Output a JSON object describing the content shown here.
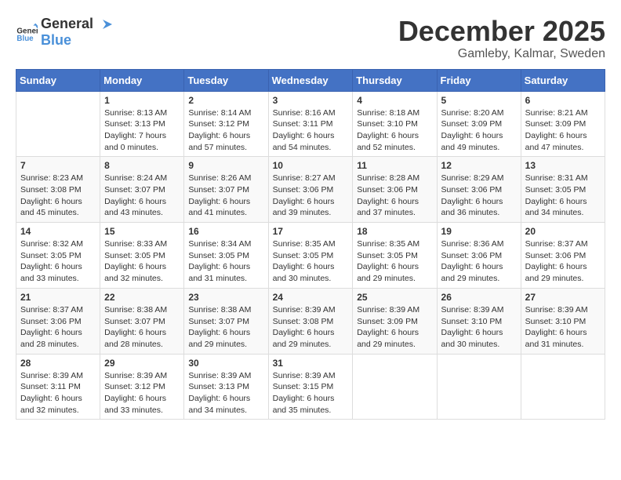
{
  "logo": {
    "general": "General",
    "blue": "Blue"
  },
  "header": {
    "month": "December 2025",
    "location": "Gamleby, Kalmar, Sweden"
  },
  "weekdays": [
    "Sunday",
    "Monday",
    "Tuesday",
    "Wednesday",
    "Thursday",
    "Friday",
    "Saturday"
  ],
  "weeks": [
    [
      {
        "day": "",
        "sunrise": "",
        "sunset": "",
        "daylight": ""
      },
      {
        "day": "1",
        "sunrise": "Sunrise: 8:13 AM",
        "sunset": "Sunset: 3:13 PM",
        "daylight": "Daylight: 7 hours and 0 minutes."
      },
      {
        "day": "2",
        "sunrise": "Sunrise: 8:14 AM",
        "sunset": "Sunset: 3:12 PM",
        "daylight": "Daylight: 6 hours and 57 minutes."
      },
      {
        "day": "3",
        "sunrise": "Sunrise: 8:16 AM",
        "sunset": "Sunset: 3:11 PM",
        "daylight": "Daylight: 6 hours and 54 minutes."
      },
      {
        "day": "4",
        "sunrise": "Sunrise: 8:18 AM",
        "sunset": "Sunset: 3:10 PM",
        "daylight": "Daylight: 6 hours and 52 minutes."
      },
      {
        "day": "5",
        "sunrise": "Sunrise: 8:20 AM",
        "sunset": "Sunset: 3:09 PM",
        "daylight": "Daylight: 6 hours and 49 minutes."
      },
      {
        "day": "6",
        "sunrise": "Sunrise: 8:21 AM",
        "sunset": "Sunset: 3:09 PM",
        "daylight": "Daylight: 6 hours and 47 minutes."
      }
    ],
    [
      {
        "day": "7",
        "sunrise": "Sunrise: 8:23 AM",
        "sunset": "Sunset: 3:08 PM",
        "daylight": "Daylight: 6 hours and 45 minutes."
      },
      {
        "day": "8",
        "sunrise": "Sunrise: 8:24 AM",
        "sunset": "Sunset: 3:07 PM",
        "daylight": "Daylight: 6 hours and 43 minutes."
      },
      {
        "day": "9",
        "sunrise": "Sunrise: 8:26 AM",
        "sunset": "Sunset: 3:07 PM",
        "daylight": "Daylight: 6 hours and 41 minutes."
      },
      {
        "day": "10",
        "sunrise": "Sunrise: 8:27 AM",
        "sunset": "Sunset: 3:06 PM",
        "daylight": "Daylight: 6 hours and 39 minutes."
      },
      {
        "day": "11",
        "sunrise": "Sunrise: 8:28 AM",
        "sunset": "Sunset: 3:06 PM",
        "daylight": "Daylight: 6 hours and 37 minutes."
      },
      {
        "day": "12",
        "sunrise": "Sunrise: 8:29 AM",
        "sunset": "Sunset: 3:06 PM",
        "daylight": "Daylight: 6 hours and 36 minutes."
      },
      {
        "day": "13",
        "sunrise": "Sunrise: 8:31 AM",
        "sunset": "Sunset: 3:05 PM",
        "daylight": "Daylight: 6 hours and 34 minutes."
      }
    ],
    [
      {
        "day": "14",
        "sunrise": "Sunrise: 8:32 AM",
        "sunset": "Sunset: 3:05 PM",
        "daylight": "Daylight: 6 hours and 33 minutes."
      },
      {
        "day": "15",
        "sunrise": "Sunrise: 8:33 AM",
        "sunset": "Sunset: 3:05 PM",
        "daylight": "Daylight: 6 hours and 32 minutes."
      },
      {
        "day": "16",
        "sunrise": "Sunrise: 8:34 AM",
        "sunset": "Sunset: 3:05 PM",
        "daylight": "Daylight: 6 hours and 31 minutes."
      },
      {
        "day": "17",
        "sunrise": "Sunrise: 8:35 AM",
        "sunset": "Sunset: 3:05 PM",
        "daylight": "Daylight: 6 hours and 30 minutes."
      },
      {
        "day": "18",
        "sunrise": "Sunrise: 8:35 AM",
        "sunset": "Sunset: 3:05 PM",
        "daylight": "Daylight: 6 hours and 29 minutes."
      },
      {
        "day": "19",
        "sunrise": "Sunrise: 8:36 AM",
        "sunset": "Sunset: 3:06 PM",
        "daylight": "Daylight: 6 hours and 29 minutes."
      },
      {
        "day": "20",
        "sunrise": "Sunrise: 8:37 AM",
        "sunset": "Sunset: 3:06 PM",
        "daylight": "Daylight: 6 hours and 29 minutes."
      }
    ],
    [
      {
        "day": "21",
        "sunrise": "Sunrise: 8:37 AM",
        "sunset": "Sunset: 3:06 PM",
        "daylight": "Daylight: 6 hours and 28 minutes."
      },
      {
        "day": "22",
        "sunrise": "Sunrise: 8:38 AM",
        "sunset": "Sunset: 3:07 PM",
        "daylight": "Daylight: 6 hours and 28 minutes."
      },
      {
        "day": "23",
        "sunrise": "Sunrise: 8:38 AM",
        "sunset": "Sunset: 3:07 PM",
        "daylight": "Daylight: 6 hours and 29 minutes."
      },
      {
        "day": "24",
        "sunrise": "Sunrise: 8:39 AM",
        "sunset": "Sunset: 3:08 PM",
        "daylight": "Daylight: 6 hours and 29 minutes."
      },
      {
        "day": "25",
        "sunrise": "Sunrise: 8:39 AM",
        "sunset": "Sunset: 3:09 PM",
        "daylight": "Daylight: 6 hours and 29 minutes."
      },
      {
        "day": "26",
        "sunrise": "Sunrise: 8:39 AM",
        "sunset": "Sunset: 3:10 PM",
        "daylight": "Daylight: 6 hours and 30 minutes."
      },
      {
        "day": "27",
        "sunrise": "Sunrise: 8:39 AM",
        "sunset": "Sunset: 3:10 PM",
        "daylight": "Daylight: 6 hours and 31 minutes."
      }
    ],
    [
      {
        "day": "28",
        "sunrise": "Sunrise: 8:39 AM",
        "sunset": "Sunset: 3:11 PM",
        "daylight": "Daylight: 6 hours and 32 minutes."
      },
      {
        "day": "29",
        "sunrise": "Sunrise: 8:39 AM",
        "sunset": "Sunset: 3:12 PM",
        "daylight": "Daylight: 6 hours and 33 minutes."
      },
      {
        "day": "30",
        "sunrise": "Sunrise: 8:39 AM",
        "sunset": "Sunset: 3:13 PM",
        "daylight": "Daylight: 6 hours and 34 minutes."
      },
      {
        "day": "31",
        "sunrise": "Sunrise: 8:39 AM",
        "sunset": "Sunset: 3:15 PM",
        "daylight": "Daylight: 6 hours and 35 minutes."
      },
      {
        "day": "",
        "sunrise": "",
        "sunset": "",
        "daylight": ""
      },
      {
        "day": "",
        "sunrise": "",
        "sunset": "",
        "daylight": ""
      },
      {
        "day": "",
        "sunrise": "",
        "sunset": "",
        "daylight": ""
      }
    ]
  ]
}
